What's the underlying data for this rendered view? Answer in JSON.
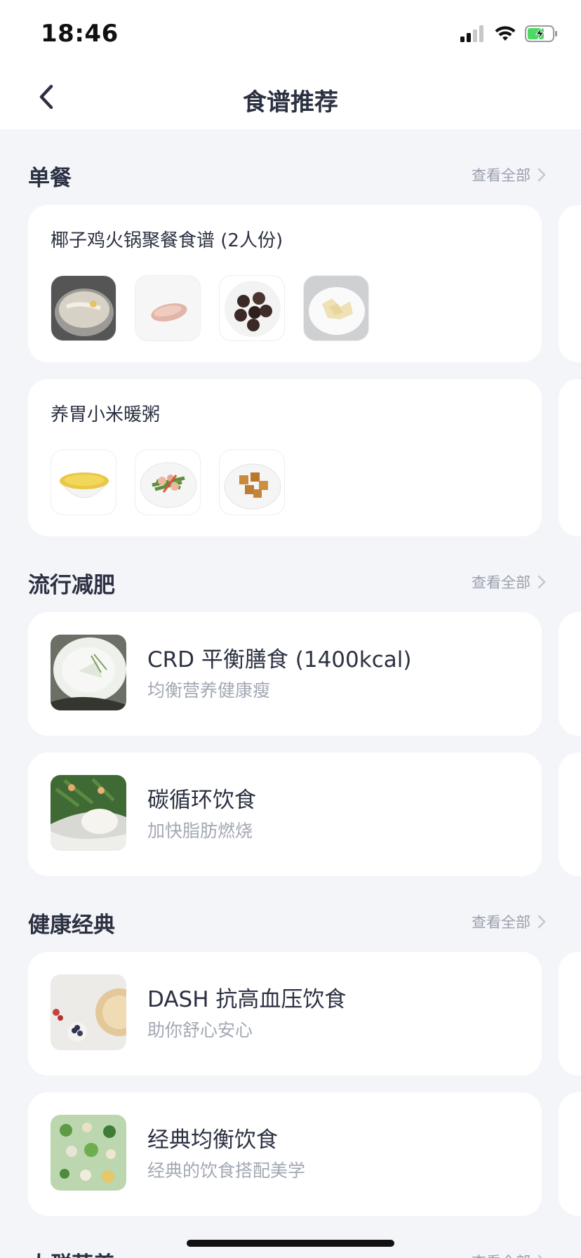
{
  "status_bar": {
    "time": "18:46"
  },
  "nav": {
    "title": "食谱推荐"
  },
  "sections": {
    "single_meal": {
      "title": "单餐",
      "see_all": "查看全部",
      "cards": [
        {
          "title": "椰子鸡火锅聚餐食谱 (2人份)",
          "thumbs": [
            "hotpot",
            "chicken-roll",
            "mushrooms",
            "bamboo-shoots"
          ]
        },
        {
          "title": "养胃小米暖粥",
          "thumbs": [
            "millet-porridge",
            "shrimp-greens",
            "tofu-dish"
          ]
        }
      ]
    },
    "popular_diet": {
      "title": "流行减肥",
      "see_all": "查看全部",
      "cards": [
        {
          "title": "CRD 平衡膳食 (1400kcal)",
          "subtitle": "均衡营养健康瘦"
        },
        {
          "title": "碳循环饮食",
          "subtitle": "加快脂肪燃烧"
        }
      ]
    },
    "healthy_classic": {
      "title": "健康经典",
      "see_all": "查看全部",
      "cards": [
        {
          "title": "DASH 抗高血压饮食",
          "subtitle": "助你舒心安心"
        },
        {
          "title": "经典均衡饮食",
          "subtitle": "经典的饮食搭配美学"
        }
      ]
    },
    "next": {
      "title": "人群营养",
      "see_all": "查看全部"
    }
  },
  "colors": {
    "background": "#f4f5f9",
    "card": "#ffffff",
    "text_primary": "#2c3142",
    "text_secondary": "#a3a8b3",
    "battery_green": "#4cd964"
  }
}
